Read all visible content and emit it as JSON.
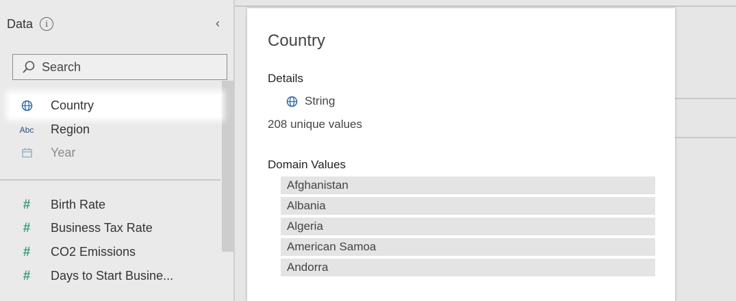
{
  "sidebar": {
    "title": "Data",
    "search": {
      "placeholder": "Search"
    },
    "dimensions": [
      {
        "label": "Country",
        "type_icon": "globe-icon",
        "selected": true
      },
      {
        "label": "Region",
        "type_icon": "abc-icon",
        "type_text": "Abc"
      },
      {
        "label": "Year",
        "type_icon": "calendar-icon",
        "dimmed": true
      }
    ],
    "measures": [
      {
        "label": "Birth Rate",
        "type_icon": "hash-icon",
        "type_text": "#"
      },
      {
        "label": "Business Tax Rate",
        "type_icon": "hash-icon",
        "type_text": "#"
      },
      {
        "label": "CO2 Emissions",
        "type_icon": "hash-icon",
        "type_text": "#"
      },
      {
        "label": "Days to Start Busine...",
        "type_icon": "hash-icon",
        "type_text": "#"
      }
    ]
  },
  "card": {
    "title": "Country",
    "details_heading": "Details",
    "data_type": "String",
    "data_type_icon": "globe-icon",
    "unique_values": "208 unique values",
    "domain_heading": "Domain Values",
    "domain_values": [
      "Afghanistan",
      "Albania",
      "Algeria",
      "American Samoa",
      "Andorra"
    ]
  },
  "colors": {
    "globe_blue": "#2b6cb0",
    "measure_green": "#3a9e7c",
    "abc_blue": "#2b4f7a"
  }
}
